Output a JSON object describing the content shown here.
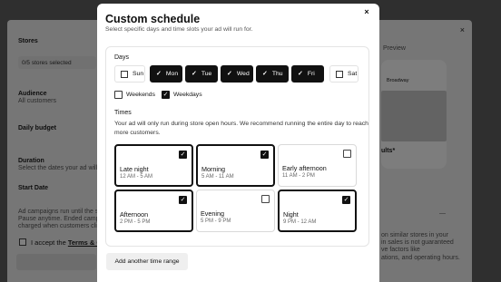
{
  "background": {
    "close_glyph": "×",
    "stores_label": "Stores",
    "stores_select": "0/5 stores selected",
    "audience_label": "Audience",
    "audience_value": "All customers",
    "daily_budget_label": "Daily budget",
    "duration_label": "Duration",
    "duration_hint": "Select the dates your ad will run",
    "start_date_label": "Start Date",
    "footnote_1": "Ad campaigns run until the spend",
    "footnote_2": "Pause anytime. Ended campaign",
    "footnote_3": "charged when customers click",
    "terms_text": "I accept the ",
    "terms_link": "Terms & C",
    "preview_label": "Preview",
    "preview_store": "Broadway",
    "results_label": "ults*",
    "range_text": "—",
    "disclaimer_1": "on similar stores in your",
    "disclaimer_2": "in sales is not guaranteed",
    "disclaimer_3": "ve factors like",
    "disclaimer_4": "ations, and operating hours."
  },
  "modal": {
    "title": "Custom schedule",
    "subtitle": "Select specific days and time slots your ad will run for.",
    "close_glyph": "×",
    "days_label": "Days",
    "days": [
      {
        "label": "Sun",
        "selected": false
      },
      {
        "label": "Mon",
        "selected": true
      },
      {
        "label": "Tue",
        "selected": true
      },
      {
        "label": "Wed",
        "selected": true
      },
      {
        "label": "Thu",
        "selected": true
      },
      {
        "label": "Fri",
        "selected": true
      },
      {
        "label": "Sat",
        "selected": false
      }
    ],
    "check_glyph": "✓",
    "weekends_label": "Weekends",
    "weekends_checked": false,
    "weekdays_label": "Weekdays",
    "weekdays_checked": true,
    "times_label": "Times",
    "times_description": "Your ad will only run during store open hours. We recommend running the entire day to reach more customers.",
    "slots": [
      {
        "name": "Late night",
        "hours": "12 AM - 5 AM",
        "selected": true
      },
      {
        "name": "Morning",
        "hours": "5 AM - 11 AM",
        "selected": true
      },
      {
        "name": "Early afternoon",
        "hours": "11 AM - 2 PM",
        "selected": false
      },
      {
        "name": "Afternoon",
        "hours": "2 PM - 5 PM",
        "selected": true
      },
      {
        "name": "Evening",
        "hours": "5 PM - 9 PM",
        "selected": false
      },
      {
        "name": "Night",
        "hours": "9 PM - 12 AM",
        "selected": true
      }
    ],
    "add_button_label": "Add another time range"
  }
}
